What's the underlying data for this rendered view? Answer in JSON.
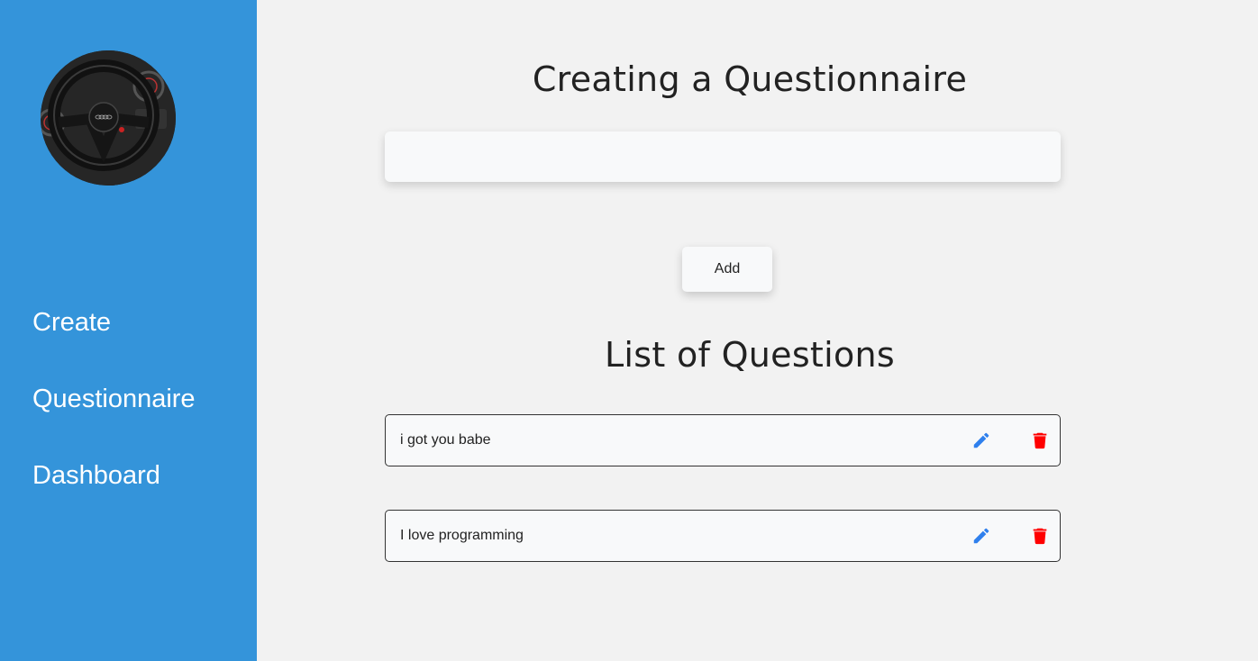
{
  "sidebar": {
    "avatar_icon": "steering-wheel-photo",
    "nav": [
      {
        "label": "Create"
      },
      {
        "label": "Questionnaire"
      },
      {
        "label": "Dashboard"
      }
    ]
  },
  "main": {
    "title": "Creating a Questionnaire",
    "question_input": {
      "value": "",
      "placeholder": ""
    },
    "add_label": "Add",
    "list_title": "List of Questions",
    "questions": [
      {
        "text": "i got you babe",
        "edit_icon": "pencil-icon",
        "delete_icon": "trash-icon"
      },
      {
        "text": "I love programming",
        "edit_icon": "pencil-icon",
        "delete_icon": "trash-icon"
      }
    ]
  },
  "colors": {
    "sidebar": "#3494da",
    "background": "#f2f2f2",
    "edit": "#2f80ed",
    "delete": "#ff0000"
  }
}
